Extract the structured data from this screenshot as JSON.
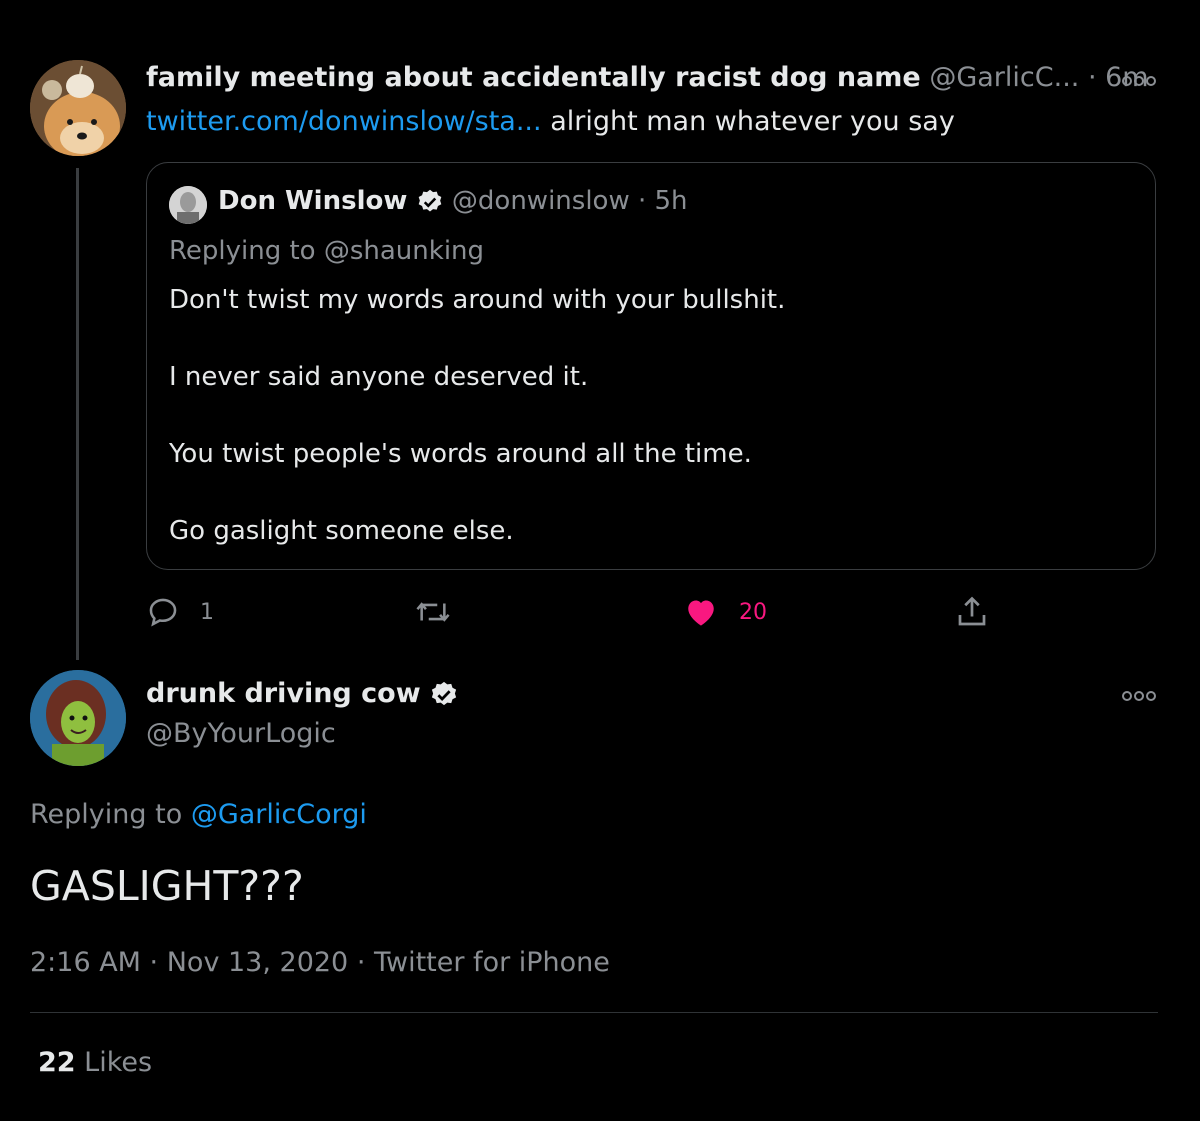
{
  "colors": {
    "background": "#000000",
    "link": "#1d9bf0",
    "like_active": "#f91880",
    "muted": "#8b8f94",
    "text": "#e7e9ea"
  },
  "tweet1": {
    "display_name": "family meeting about accidentally racist dog name",
    "handle_time": "@GarlicC... · 6m",
    "link_text": "twitter.com/donwinslow/sta...",
    "body": " alright man whatever you say",
    "more_icon": "more-dots-icon",
    "quote": {
      "display_name": "Don Winslow",
      "handle_time": "@donwinslow · 5h",
      "replying_to": "Replying to @shaunking",
      "lines": [
        "Don't twist my words around with your bullshit.",
        "I never said anyone deserved it.",
        "You twist people's words around all the time.",
        "Go gaslight someone else."
      ]
    },
    "actions": {
      "reply_count": "1",
      "retweet_count": "",
      "like_count": "20"
    }
  },
  "tweet2": {
    "display_name": "drunk driving cow",
    "handle": "@ByYourLogic",
    "replying_prefix": "Replying to ",
    "replying_handle": "@GarlicCorgi",
    "body": "GASLIGHT???",
    "meta": "2:16 AM · Nov 13, 2020 · Twitter for iPhone",
    "likes_count": "22",
    "likes_label": " Likes"
  }
}
